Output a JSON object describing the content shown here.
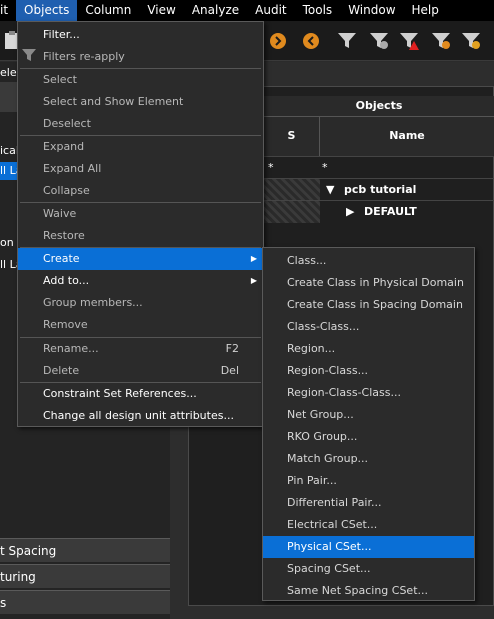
{
  "menubar": {
    "items": [
      "it",
      "Objects",
      "Column",
      "View",
      "Analyze",
      "Audit",
      "Tools",
      "Window",
      "Help"
    ]
  },
  "left_panel": {
    "strip_texts": [
      "elect",
      "ical",
      "ll La",
      "on",
      "ll La"
    ],
    "bottom_tabs": [
      "t Spacing",
      "turing",
      "s"
    ]
  },
  "worksheet": {
    "objects_header": "Objects",
    "col_s": "S",
    "col_name": "Name",
    "filter_row": [
      "*",
      "*"
    ],
    "rows": [
      {
        "expander": "▼",
        "name": "pcb tutorial"
      },
      {
        "expander": "▶",
        "name": "DEFAULT"
      }
    ]
  },
  "objects_menu": {
    "items": [
      {
        "label": "Filter...",
        "enabled": true
      },
      {
        "label": "Filters re-apply",
        "enabled": false
      },
      {
        "label": "Select",
        "enabled": false
      },
      {
        "label": "Select and Show Element",
        "enabled": false
      },
      {
        "label": "Deselect",
        "enabled": false
      },
      {
        "label": "Expand",
        "enabled": false
      },
      {
        "label": "Expand All",
        "enabled": false
      },
      {
        "label": "Collapse",
        "enabled": false
      },
      {
        "label": "Waive",
        "enabled": false
      },
      {
        "label": "Restore",
        "enabled": false
      },
      {
        "label": "Create",
        "enabled": true
      },
      {
        "label": "Add to...",
        "enabled": true
      },
      {
        "label": "Group members...",
        "enabled": false
      },
      {
        "label": "Remove",
        "enabled": false
      },
      {
        "label": "Rename...",
        "enabled": false,
        "shortcut": "F2"
      },
      {
        "label": "Delete",
        "enabled": false,
        "shortcut": "Del"
      },
      {
        "label": "Constraint Set References...",
        "enabled": true
      },
      {
        "label": "Change all design unit attributes...",
        "enabled": true
      }
    ]
  },
  "create_submenu": {
    "items": [
      "Class...",
      "Create Class in Physical Domain",
      "Create Class in Spacing Domain",
      "Class-Class...",
      "Region...",
      "Region-Class...",
      "Region-Class-Class...",
      "Net Group...",
      "RKO Group...",
      "Match Group...",
      "Pin Pair...",
      "Differential Pair...",
      "Electrical CSet...",
      "Physical CSet...",
      "Spacing CSet...",
      "Same Net Spacing CSet..."
    ],
    "selected": "Physical CSet..."
  },
  "colors": {
    "menubar_bg": "#000000",
    "menu_bg": "#2b2b2b",
    "highlight": "#0a6fd6",
    "active_menu": "#1f5fb0"
  }
}
